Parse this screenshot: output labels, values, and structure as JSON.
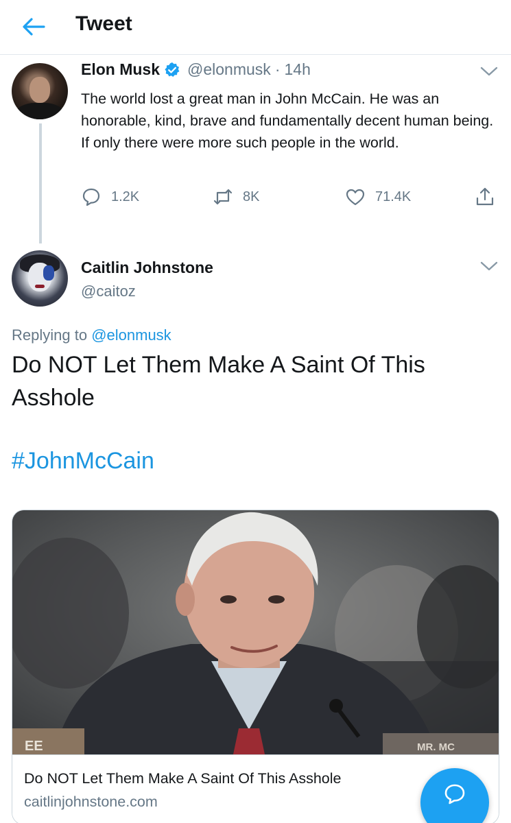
{
  "header": {
    "title": "Tweet"
  },
  "tweet": {
    "author_name": "Elon Musk",
    "handle": "@elonmusk",
    "separator": "·",
    "time": "14h",
    "text": "The world lost a great man in John McCain. He was an honorable, kind, brave and fundamentally decent human being. If only there were more such people in the world.",
    "replies": "1.2K",
    "retweets": "8K",
    "likes": "71.4K"
  },
  "reply": {
    "author_name": "Caitlin Johnstone",
    "handle": "@caitoz",
    "replying_prefix": "Replying to ",
    "replying_to": "@elonmusk",
    "text": "Do NOT Let Them Make A Saint Of This Asshole",
    "hashtag": "#JohnMcCain",
    "card": {
      "title": "Do NOT Let Them Make A Saint Of This Asshole",
      "domain": "caitlinjohnstone.com",
      "nameplate": "MR. MC",
      "nameplate_left": "EE"
    }
  },
  "colors": {
    "accent": "#1da1f2",
    "link": "#1b95e0",
    "secondary_text": "#657786",
    "border": "#ccd6dd"
  },
  "icons": [
    "back-arrow-icon",
    "verified-badge-icon",
    "chevron-down-icon",
    "reply-icon",
    "retweet-icon",
    "like-icon",
    "share-icon",
    "compose-reply-icon"
  ]
}
